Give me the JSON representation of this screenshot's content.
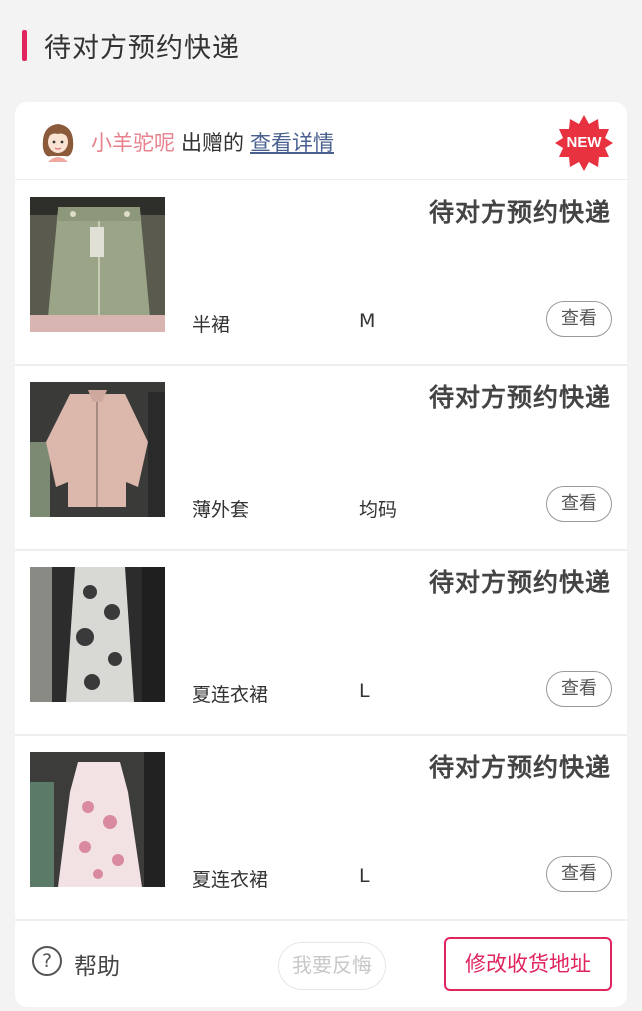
{
  "page": {
    "section_title": "待对方预约快递"
  },
  "donor": {
    "name": "小羊驼呢",
    "verb": "出赠的",
    "link_label": "查看详情",
    "badge": "NEW"
  },
  "items": [
    {
      "status": "待对方预约快递",
      "name": "半裙",
      "size": "M",
      "view_label": "查看"
    },
    {
      "status": "待对方预约快递",
      "name": "薄外套",
      "size": "均码",
      "view_label": "查看"
    },
    {
      "status": "待对方预约快递",
      "name": "夏连衣裙",
      "size": "L",
      "view_label": "查看"
    },
    {
      "status": "待对方预约快递",
      "name": "夏连衣裙",
      "size": "L",
      "view_label": "查看"
    }
  ],
  "footer": {
    "help_label": "帮助",
    "regret_label": "我要反悔",
    "address_label": "修改收货地址"
  },
  "colors": {
    "accent": "#e0245e",
    "donor_name": "#e8818c",
    "link": "#4a6090"
  }
}
